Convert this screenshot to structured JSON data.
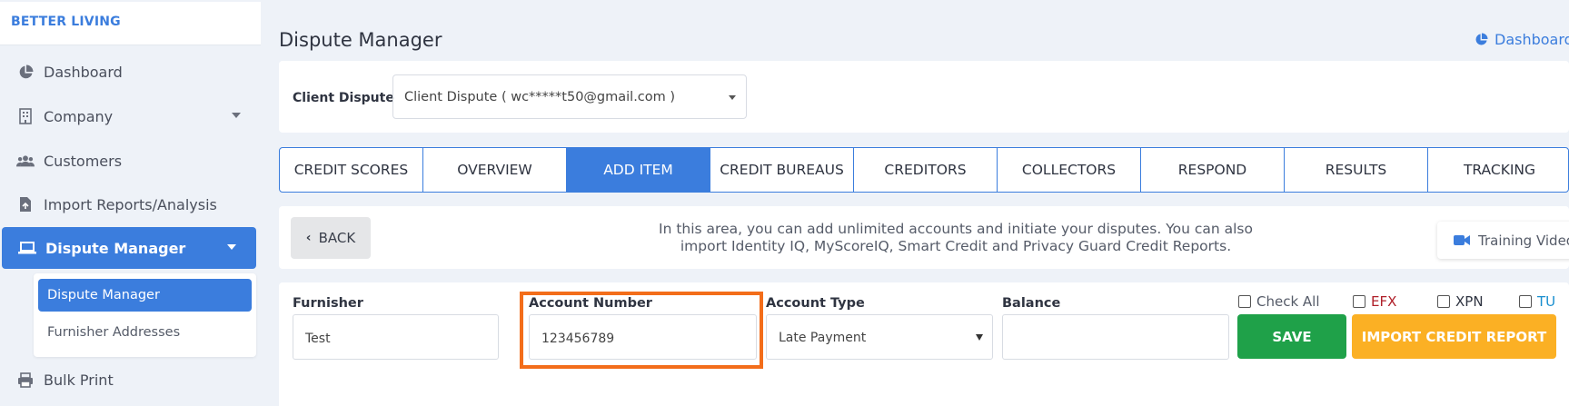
{
  "sidebar": {
    "brand": "BETTER LIVING",
    "items": [
      {
        "label": "Dashboard",
        "icon": "pie-chart-icon"
      },
      {
        "label": "Company",
        "icon": "building-icon"
      },
      {
        "label": "Customers",
        "icon": "users-icon"
      },
      {
        "label": "Import Reports/Analysis",
        "icon": "file-import-icon"
      },
      {
        "label": "Dispute Manager",
        "icon": "laptop-icon"
      },
      {
        "label": "Bulk Print",
        "icon": "printer-icon"
      }
    ],
    "submenu": [
      "Dispute Manager",
      "Furnisher Addresses"
    ]
  },
  "header": {
    "title": "Dispute Manager",
    "dashboard_link": "Dashboard"
  },
  "client": {
    "label": "Client Dispute",
    "selected": "Client Dispute ( wc*****t50@gmail.com )"
  },
  "tabs": [
    "CREDIT SCORES",
    "OVERVIEW",
    "ADD ITEM",
    "CREDIT BUREAUS",
    "CREDITORS",
    "COLLECTORS",
    "RESPOND",
    "RESULTS",
    "TRACKING"
  ],
  "active_tab": "ADD ITEM",
  "info": {
    "back_label": "BACK",
    "text": "In this area, you can add unlimited accounts and initiate your disputes. You can also import Identity IQ, MyScoreIQ, Smart Credit and Privacy Guard Credit Reports.",
    "training_label": "Training Video"
  },
  "form": {
    "furnisher_label": "Furnisher",
    "furnisher_value": "Test",
    "account_number_label": "Account Number",
    "account_number_value": "123456789",
    "account_type_label": "Account Type",
    "account_type_value": "Late Payment",
    "balance_label": "Balance",
    "balance_value": "",
    "check_all": "Check All",
    "efx": "EFX",
    "xpn": "XPN",
    "tu": "TU",
    "save": "SAVE",
    "import": "IMPORT CREDIT REPORT"
  },
  "colors": {
    "primary": "#3b7ddd",
    "save": "#1fa149",
    "import": "#fbb024",
    "highlight": "#f36d1a",
    "efx": "#b0202a",
    "tu": "#1a8fcf"
  }
}
